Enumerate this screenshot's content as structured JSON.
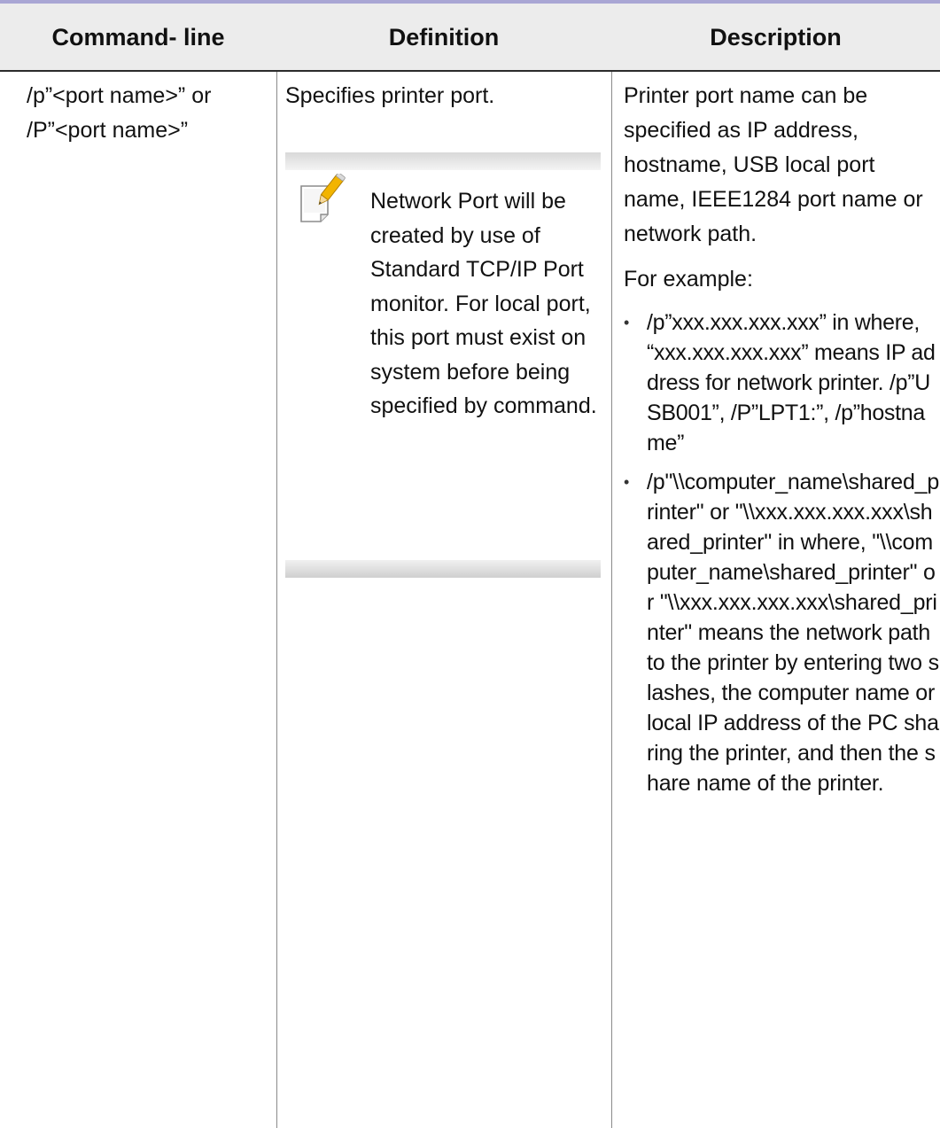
{
  "table": {
    "headers": {
      "command_line": "Command- line",
      "definition": "Definition",
      "description": "Description"
    },
    "row": {
      "command_lines": [
        "/p”<port name>” or",
        "/P”<port name>”"
      ],
      "definition": "Specifies printer port.",
      "note": {
        "icon": "note-pencil-icon",
        "text": "Network Port will be created by use of Standard TCP/IP Port monitor. For local port, this port must exist on system before being specified by command."
      },
      "description": {
        "intro": "Printer port name can be specified as IP address, hostname, USB local port name, IEEE1284 port name or network path.",
        "example_label": "For example:",
        "bullets": [
          "/p”xxx.xxx.xxx.xxx” in where, “xxx.xxx.xxx.xxx” means IP address for network printer. /p”USB001”, /P”LPT1:”, /p”hostname”",
          "/p\"\\\\computer_name\\shared_printer\" or \"\\\\xxx.xxx.xxx.xxx\\shared_printer\" in where, \"\\\\computer_name\\shared_printer\" or \"\\\\xxx.xxx.xxx.xxx\\shared_printer\" means the network path to the printer by entering two slashes, the computer name or local IP address of the PC sharing the printer, and then the share name of the printer."
        ]
      }
    }
  },
  "colors": {
    "header_background": "#ececec",
    "top_rule": "#a9a6d4",
    "note_pencil": "#f2b400"
  }
}
